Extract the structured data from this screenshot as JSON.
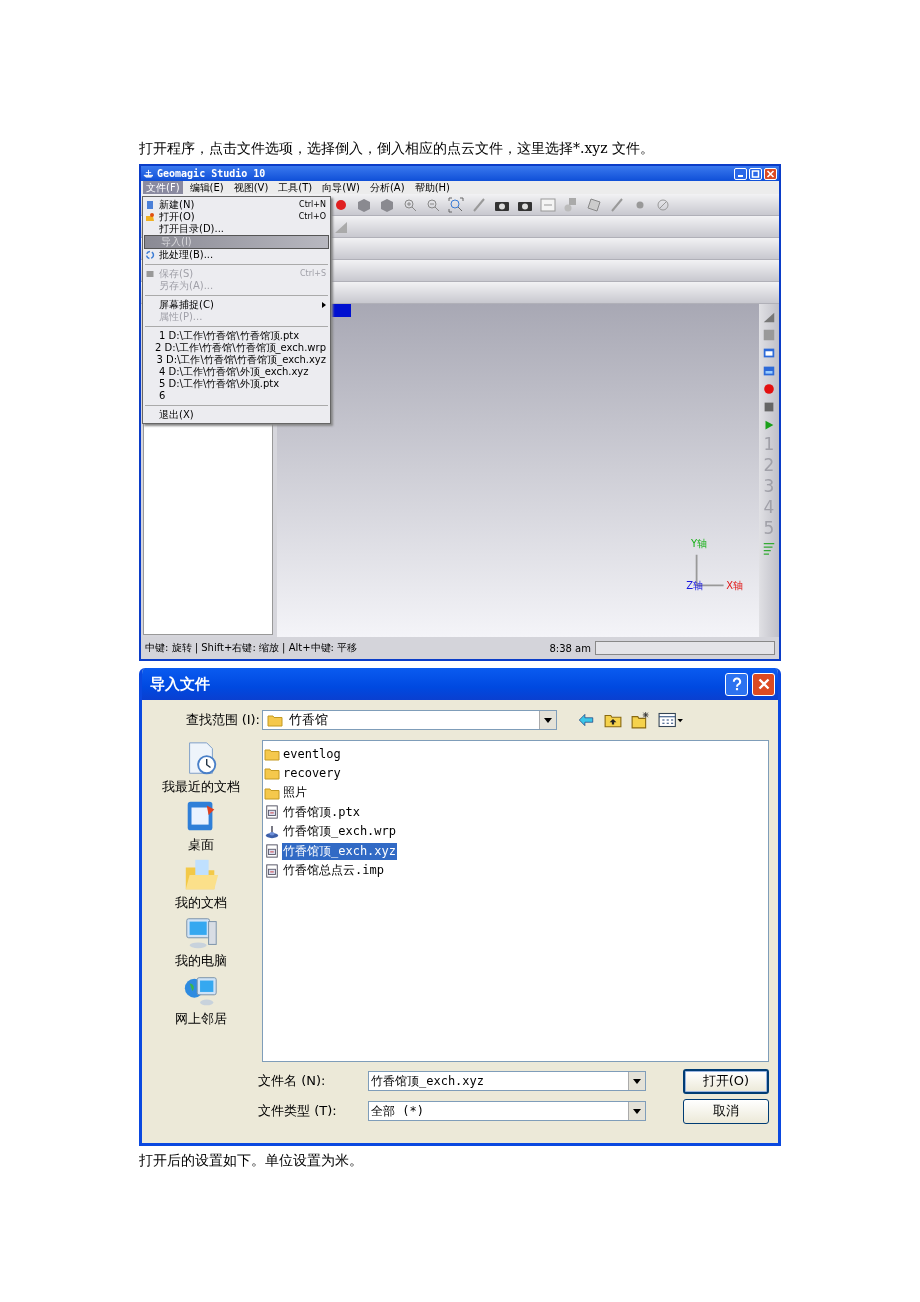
{
  "intro": "打开程序，点击文件选项，选择倒入，倒入相应的点云文件，这里选择*.xyz 文件。",
  "app_window": {
    "title": "Geomagic Studio 10",
    "menus": [
      {
        "label": "文件(F)",
        "selected": true
      },
      {
        "label": "编辑(E)",
        "selected": false
      },
      {
        "label": "视图(V)",
        "selected": false
      },
      {
        "label": "工具(T)",
        "selected": false
      },
      {
        "label": "向导(W)",
        "selected": false
      },
      {
        "label": "分析(A)",
        "selected": false
      },
      {
        "label": "帮助(H)",
        "selected": false
      }
    ],
    "file_menu": [
      {
        "kind": "item",
        "label": "新建(N)",
        "shortcut": "Ctrl+N",
        "disabled": false,
        "selected": false
      },
      {
        "kind": "item",
        "label": "打开(O)",
        "shortcut": "Ctrl+O",
        "disabled": false,
        "selected": false
      },
      {
        "kind": "item",
        "label": "打开目录(D)...",
        "disabled": false,
        "selected": false
      },
      {
        "kind": "item",
        "label": "导入(I)",
        "disabled": true,
        "selected": true
      },
      {
        "kind": "item",
        "label": "批处理(B)...",
        "disabled": false,
        "selected": false
      },
      {
        "kind": "separator"
      },
      {
        "kind": "item",
        "label": "保存(S)",
        "shortcut": "Ctrl+S",
        "disabled": true,
        "selected": false
      },
      {
        "kind": "item",
        "label": "另存为(A)...",
        "disabled": true,
        "selected": false
      },
      {
        "kind": "separator"
      },
      {
        "kind": "submenu",
        "label": "屏幕捕捉(C)",
        "disabled": false,
        "selected": false
      },
      {
        "kind": "item",
        "label": "属性(P)...",
        "disabled": true,
        "selected": false
      },
      {
        "kind": "separator"
      },
      {
        "kind": "item",
        "label": "1 D:\\工作\\竹香馆\\竹香馆顶.ptx",
        "disabled": false,
        "selected": false
      },
      {
        "kind": "item",
        "label": "2 D:\\工作\\竹香馆\\竹香馆顶_exch.wrp",
        "disabled": false,
        "selected": false
      },
      {
        "kind": "item",
        "label": "3 D:\\工作\\竹香馆\\竹香馆顶_exch.xyz",
        "disabled": false,
        "selected": false
      },
      {
        "kind": "item",
        "label": "4 D:\\工作\\竹香馆\\外顶_exch.xyz",
        "disabled": false,
        "selected": false
      },
      {
        "kind": "item",
        "label": "5 D:\\工作\\竹香馆\\外顶.ptx",
        "disabled": false,
        "selected": false
      },
      {
        "kind": "item",
        "label": "6",
        "disabled": false,
        "selected": false
      },
      {
        "kind": "separator"
      },
      {
        "kind": "item",
        "label": "退出(X)",
        "disabled": false,
        "selected": false
      }
    ],
    "viewpoints": [
      "1",
      "2",
      "3",
      "4",
      "5"
    ],
    "axes": {
      "y": "Y轴",
      "z": "Z轴",
      "x": "X轴"
    },
    "status_bar": {
      "hint": "中键: 旋转 | Shift+右键: 缩放 | Alt+中键: 平移",
      "time": "8:38 am"
    }
  },
  "dialog": {
    "title": "导入文件",
    "look_in_label": "查找范围 (I):",
    "look_in_value": "竹香馆",
    "places": [
      {
        "kind": "recent",
        "label": "我最近的文档"
      },
      {
        "kind": "desktop",
        "label": "桌面"
      },
      {
        "kind": "documents",
        "label": "我的文档"
      },
      {
        "kind": "computer",
        "label": "我的电脑"
      },
      {
        "kind": "network",
        "label": "网上邻居"
      }
    ],
    "files": [
      {
        "kind": "folder",
        "name": "eventlog",
        "selected": false
      },
      {
        "kind": "folder",
        "name": "recovery",
        "selected": false
      },
      {
        "kind": "folder",
        "name": "照片",
        "selected": false
      },
      {
        "kind": "document",
        "name": "竹香馆顶.ptx",
        "selected": false
      },
      {
        "kind": "mesh",
        "name": "竹香馆顶_exch.wrp",
        "selected": false
      },
      {
        "kind": "document",
        "name": "竹香馆顶_exch.xyz",
        "selected": true
      },
      {
        "kind": "document",
        "name": "竹香馆总点云.imp",
        "selected": false
      }
    ],
    "file_name_label": "文件名 (N):",
    "file_name_value": "竹香馆顶_exch.xyz",
    "file_type_label": "文件类型 (T):",
    "file_type_value": "全部 (*)",
    "buttons": [
      "打开(O)",
      "取消"
    ]
  },
  "after": "打开后的设置如下。单位设置为米。"
}
